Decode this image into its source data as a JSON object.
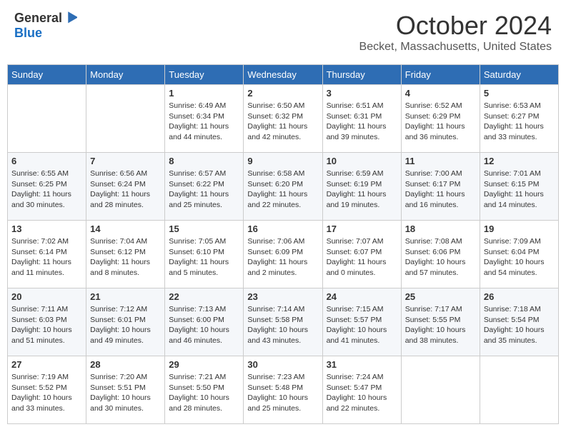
{
  "header": {
    "logo_general": "General",
    "logo_blue": "Blue",
    "month_title": "October 2024",
    "location": "Becket, Massachusetts, United States"
  },
  "days_of_week": [
    "Sunday",
    "Monday",
    "Tuesday",
    "Wednesday",
    "Thursday",
    "Friday",
    "Saturday"
  ],
  "weeks": [
    [
      {
        "day": "",
        "detail": ""
      },
      {
        "day": "",
        "detail": ""
      },
      {
        "day": "1",
        "detail": "Sunrise: 6:49 AM\nSunset: 6:34 PM\nDaylight: 11 hours and 44 minutes."
      },
      {
        "day": "2",
        "detail": "Sunrise: 6:50 AM\nSunset: 6:32 PM\nDaylight: 11 hours and 42 minutes."
      },
      {
        "day": "3",
        "detail": "Sunrise: 6:51 AM\nSunset: 6:31 PM\nDaylight: 11 hours and 39 minutes."
      },
      {
        "day": "4",
        "detail": "Sunrise: 6:52 AM\nSunset: 6:29 PM\nDaylight: 11 hours and 36 minutes."
      },
      {
        "day": "5",
        "detail": "Sunrise: 6:53 AM\nSunset: 6:27 PM\nDaylight: 11 hours and 33 minutes."
      }
    ],
    [
      {
        "day": "6",
        "detail": "Sunrise: 6:55 AM\nSunset: 6:25 PM\nDaylight: 11 hours and 30 minutes."
      },
      {
        "day": "7",
        "detail": "Sunrise: 6:56 AM\nSunset: 6:24 PM\nDaylight: 11 hours and 28 minutes."
      },
      {
        "day": "8",
        "detail": "Sunrise: 6:57 AM\nSunset: 6:22 PM\nDaylight: 11 hours and 25 minutes."
      },
      {
        "day": "9",
        "detail": "Sunrise: 6:58 AM\nSunset: 6:20 PM\nDaylight: 11 hours and 22 minutes."
      },
      {
        "day": "10",
        "detail": "Sunrise: 6:59 AM\nSunset: 6:19 PM\nDaylight: 11 hours and 19 minutes."
      },
      {
        "day": "11",
        "detail": "Sunrise: 7:00 AM\nSunset: 6:17 PM\nDaylight: 11 hours and 16 minutes."
      },
      {
        "day": "12",
        "detail": "Sunrise: 7:01 AM\nSunset: 6:15 PM\nDaylight: 11 hours and 14 minutes."
      }
    ],
    [
      {
        "day": "13",
        "detail": "Sunrise: 7:02 AM\nSunset: 6:14 PM\nDaylight: 11 hours and 11 minutes."
      },
      {
        "day": "14",
        "detail": "Sunrise: 7:04 AM\nSunset: 6:12 PM\nDaylight: 11 hours and 8 minutes."
      },
      {
        "day": "15",
        "detail": "Sunrise: 7:05 AM\nSunset: 6:10 PM\nDaylight: 11 hours and 5 minutes."
      },
      {
        "day": "16",
        "detail": "Sunrise: 7:06 AM\nSunset: 6:09 PM\nDaylight: 11 hours and 2 minutes."
      },
      {
        "day": "17",
        "detail": "Sunrise: 7:07 AM\nSunset: 6:07 PM\nDaylight: 11 hours and 0 minutes."
      },
      {
        "day": "18",
        "detail": "Sunrise: 7:08 AM\nSunset: 6:06 PM\nDaylight: 10 hours and 57 minutes."
      },
      {
        "day": "19",
        "detail": "Sunrise: 7:09 AM\nSunset: 6:04 PM\nDaylight: 10 hours and 54 minutes."
      }
    ],
    [
      {
        "day": "20",
        "detail": "Sunrise: 7:11 AM\nSunset: 6:03 PM\nDaylight: 10 hours and 51 minutes."
      },
      {
        "day": "21",
        "detail": "Sunrise: 7:12 AM\nSunset: 6:01 PM\nDaylight: 10 hours and 49 minutes."
      },
      {
        "day": "22",
        "detail": "Sunrise: 7:13 AM\nSunset: 6:00 PM\nDaylight: 10 hours and 46 minutes."
      },
      {
        "day": "23",
        "detail": "Sunrise: 7:14 AM\nSunset: 5:58 PM\nDaylight: 10 hours and 43 minutes."
      },
      {
        "day": "24",
        "detail": "Sunrise: 7:15 AM\nSunset: 5:57 PM\nDaylight: 10 hours and 41 minutes."
      },
      {
        "day": "25",
        "detail": "Sunrise: 7:17 AM\nSunset: 5:55 PM\nDaylight: 10 hours and 38 minutes."
      },
      {
        "day": "26",
        "detail": "Sunrise: 7:18 AM\nSunset: 5:54 PM\nDaylight: 10 hours and 35 minutes."
      }
    ],
    [
      {
        "day": "27",
        "detail": "Sunrise: 7:19 AM\nSunset: 5:52 PM\nDaylight: 10 hours and 33 minutes."
      },
      {
        "day": "28",
        "detail": "Sunrise: 7:20 AM\nSunset: 5:51 PM\nDaylight: 10 hours and 30 minutes."
      },
      {
        "day": "29",
        "detail": "Sunrise: 7:21 AM\nSunset: 5:50 PM\nDaylight: 10 hours and 28 minutes."
      },
      {
        "day": "30",
        "detail": "Sunrise: 7:23 AM\nSunset: 5:48 PM\nDaylight: 10 hours and 25 minutes."
      },
      {
        "day": "31",
        "detail": "Sunrise: 7:24 AM\nSunset: 5:47 PM\nDaylight: 10 hours and 22 minutes."
      },
      {
        "day": "",
        "detail": ""
      },
      {
        "day": "",
        "detail": ""
      }
    ]
  ]
}
